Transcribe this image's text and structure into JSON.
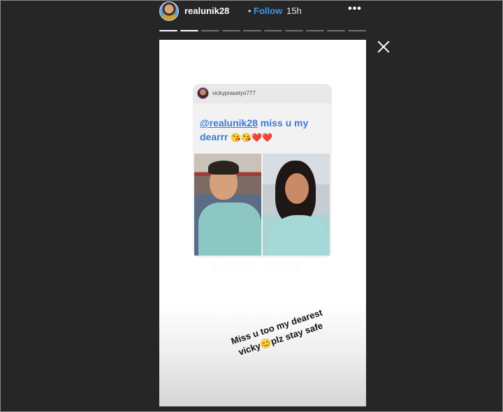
{
  "header": {
    "username": "realunik28",
    "separator": "•",
    "follow_label": "Follow",
    "time_ago": "15h",
    "more_label": "•••"
  },
  "progress": {
    "segments": 10,
    "current": 2
  },
  "story": {
    "shared_post": {
      "username": "vickyprasetyo777",
      "caption_mention": "@realunik28",
      "caption_text": " miss u my dearrr",
      "caption_emojis": "😘😘❤️❤️",
      "date_stamp": "3 APR 2020"
    },
    "reply_text": "Miss u too my dearest vicky😊plz stay safe"
  },
  "colors": {
    "background": "#262626",
    "follow_blue": "#3897f0",
    "caption_blue": "#3a7bd5",
    "story_bg": "#ffffff"
  },
  "icons": {
    "close": "close-icon",
    "more": "more-options-icon"
  }
}
